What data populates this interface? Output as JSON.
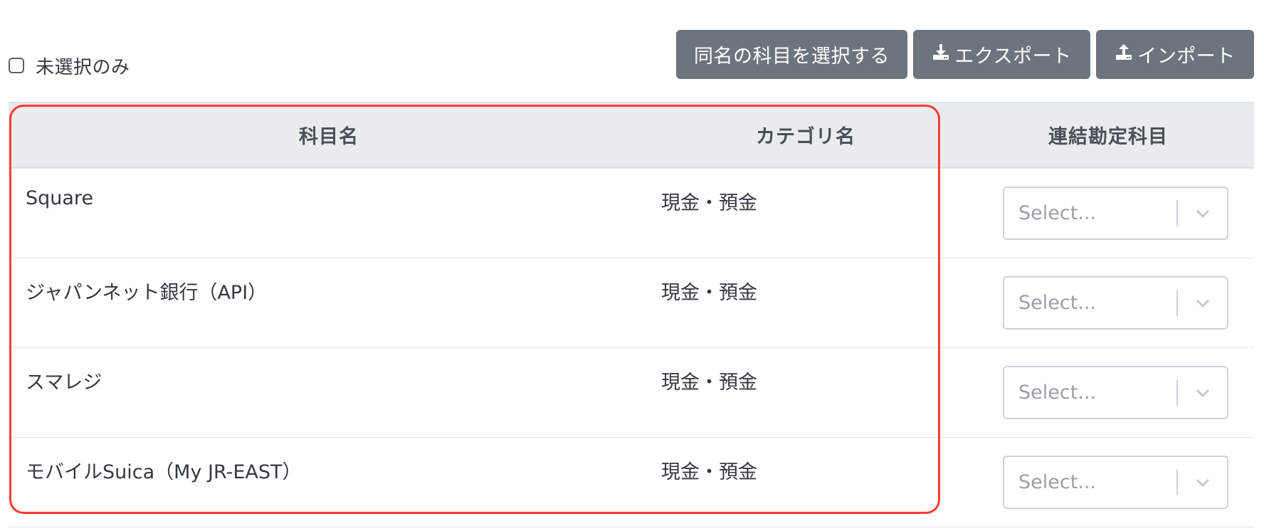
{
  "filter": {
    "unselected_only_label": "未選択のみ"
  },
  "toolbar": {
    "select_same_name_label": "同名の科目を選択する",
    "export_label": "エクスポート",
    "import_label": "インポート"
  },
  "table": {
    "headers": {
      "name": "科目名",
      "category": "カテゴリ名",
      "linked_account": "連結勘定科目"
    },
    "rows": [
      {
        "name": "Square",
        "category": "現金・預金",
        "linked_account_placeholder": "Select..."
      },
      {
        "name": "ジャパンネット銀行（API）",
        "category": "現金・預金",
        "linked_account_placeholder": "Select..."
      },
      {
        "name": "スマレジ",
        "category": "現金・預金",
        "linked_account_placeholder": "Select..."
      },
      {
        "name": "モバイルSuica（My JR-EAST）",
        "category": "現金・預金",
        "linked_account_placeholder": "Select..."
      }
    ]
  },
  "icons": {
    "export": "download-icon",
    "import": "upload-icon",
    "select": "chevron-down-icon"
  },
  "colors": {
    "button_bg": "#6c757d",
    "header_bg": "#e9ecef",
    "highlight_border": "#ff3b30"
  }
}
